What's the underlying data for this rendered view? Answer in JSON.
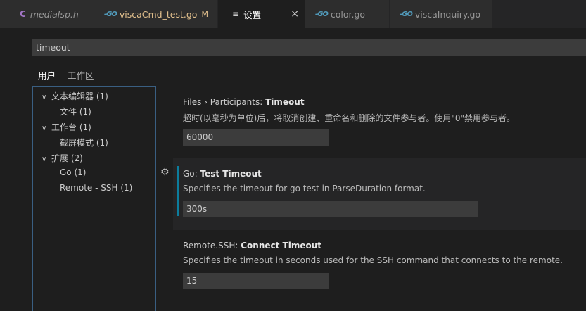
{
  "tabs": [
    {
      "label": "mediaIsp.h",
      "icon": "c-file-icon",
      "icon_text": "C"
    },
    {
      "label": "viscaCmd_test.go",
      "icon": "go-file-icon",
      "icon_text": "-GO",
      "badge": "M"
    },
    {
      "label": "设置",
      "icon": "settings-file-icon",
      "icon_text": "≡",
      "close": "×",
      "active": true
    },
    {
      "label": "color.go",
      "icon": "go-file-icon",
      "icon_text": "-GO"
    },
    {
      "label": "viscaInquiry.go",
      "icon": "go-file-icon",
      "icon_text": "-GO"
    }
  ],
  "search": {
    "value": "timeout"
  },
  "scopes": {
    "user": "用户",
    "workspace": "工作区"
  },
  "toc": [
    {
      "label": "文本编辑器 (1)",
      "chevron": "∨"
    },
    {
      "label": "文件 (1)"
    },
    {
      "label": "工作台 (1)",
      "chevron": "∨"
    },
    {
      "label": "截屏模式 (1)"
    },
    {
      "label": "扩展 (2)",
      "chevron": "∨"
    },
    {
      "label": "Go (1)"
    },
    {
      "label": "Remote - SSH (1)"
    }
  ],
  "settings": [
    {
      "category": "Files › Participants: ",
      "name": "Timeout",
      "description": "超时(以毫秒为单位)后，将取消创建、重命名和删除的文件参与者。使用\"0\"禁用参与者。",
      "value": "60000"
    },
    {
      "category": "Go: ",
      "name": "Test Timeout",
      "description": "Specifies the timeout for go test in ParseDuration format.",
      "value": "300s",
      "modified": true
    },
    {
      "category": "Remote.SSH: ",
      "name": "Connect Timeout",
      "description": "Specifies the timeout in seconds used for the SSH command that connects to the remote.",
      "value": "15"
    }
  ],
  "colors": {
    "accent": "#0c7d9d",
    "modified": "#e2c08d",
    "go": "#519aba"
  }
}
